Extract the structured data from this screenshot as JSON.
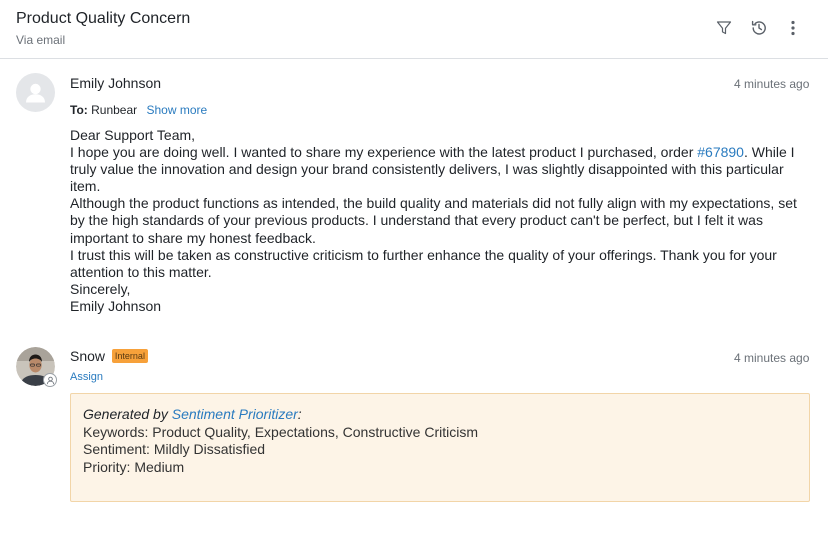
{
  "header": {
    "title": "Product Quality Concern",
    "subtitle": "Via email"
  },
  "message": {
    "sender": "Emily Johnson",
    "time": "4 minutes ago",
    "to_label": "To:",
    "to_value": "Runbear",
    "show_more": "Show more",
    "lines": {
      "l1": "Dear Support Team,",
      "l2a": "I hope you are doing well. I wanted to share my experience with the latest product I purchased, order ",
      "order": "#67890",
      "l2b": ". While I truly value the innovation and design your brand consistently delivers, I was slightly disappointed with this particular item.",
      "l3": "Although the product functions as intended, the build quality and materials did not fully align with my expectations, set by the high standards of your previous products. I understand that every product can't be perfect, but I felt it was important to share my honest feedback.",
      "l4": "I trust this will be taken as constructive criticism to further enhance the quality of your offerings. Thank you for your attention to this matter.",
      "l5": "Sincerely,",
      "l6": "Emily Johnson"
    }
  },
  "reply": {
    "sender": "Snow",
    "badge": "Internal",
    "time": "4 minutes ago",
    "assign": "Assign",
    "generated_by": "Generated by",
    "generator": "Sentiment Prioritizer",
    "colon": ":",
    "keywords": "Keywords: Product Quality, Expectations, Constructive Criticism",
    "sentiment": "Sentiment: Mildly Dissatisfied",
    "priority": "Priority: Medium"
  },
  "icons": [
    "filter-icon",
    "history-icon",
    "more-vertical-icon",
    "user-avatar-icon",
    "assign-user-icon"
  ],
  "colors": {
    "link": "#2a7bbf",
    "badge": "#f7a13a",
    "note_bg": "#fdf4e7",
    "note_border": "#f2d5a8"
  }
}
